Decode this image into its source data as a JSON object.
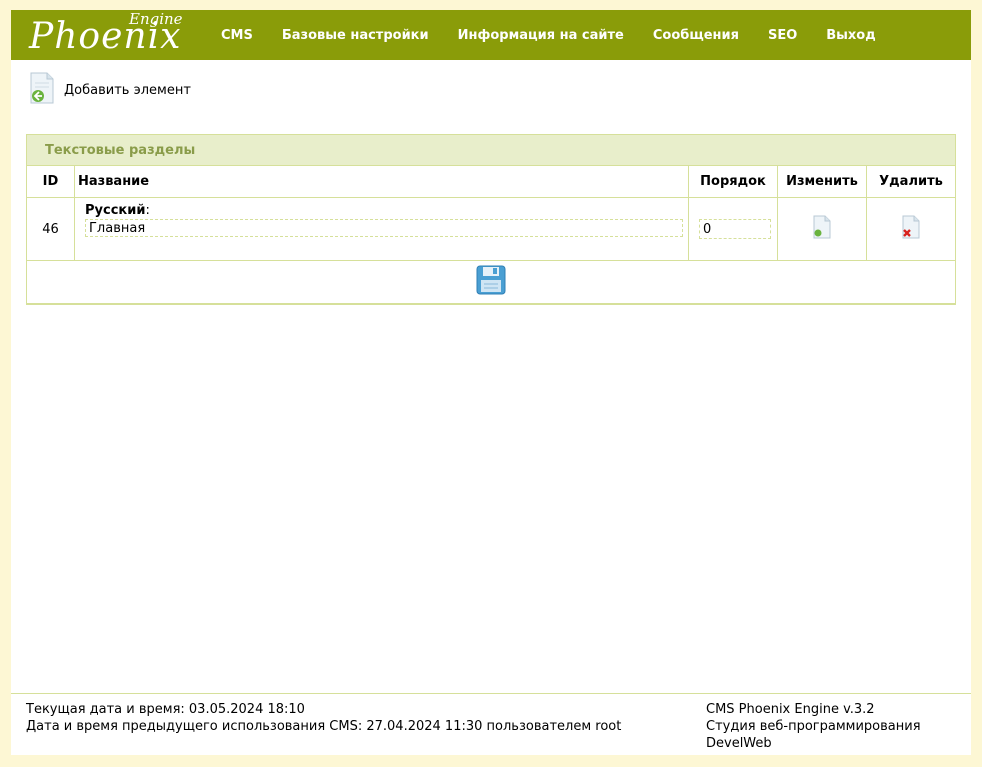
{
  "header": {
    "logo_main": "Phoenix",
    "logo_sub": "Engine",
    "nav": [
      "CMS",
      "Базовые настройки",
      "Информация на сайте",
      "Сообщения",
      "SEO",
      "Выход"
    ]
  },
  "toolbar": {
    "add_label": "Добавить элемент"
  },
  "panel": {
    "title": "Текстовые разделы",
    "columns": {
      "id": "ID",
      "name": "Название",
      "order": "Порядок",
      "edit": "Изменить",
      "delete": "Удалить"
    },
    "rows": [
      {
        "id": "46",
        "lang_label": "Русский",
        "name_value": "Главная",
        "order_value": "0"
      }
    ]
  },
  "footer": {
    "datetime_line": "Текущая дата и время: 03.05.2024 18:10",
    "last_use_line": "Дата и время предыдущего использования CMS: 27.04.2024 11:30 пользователем root",
    "version": "CMS Phoenix Engine v.3.2",
    "studio": "Студия веб-программирования DevelWeb"
  },
  "colors": {
    "header_bg": "#8a9c09",
    "page_bg": "#fdf7d4",
    "panel_title_bg": "#e8eecb",
    "panel_title_text": "#8a9c4a",
    "border": "#d6e09a"
  }
}
